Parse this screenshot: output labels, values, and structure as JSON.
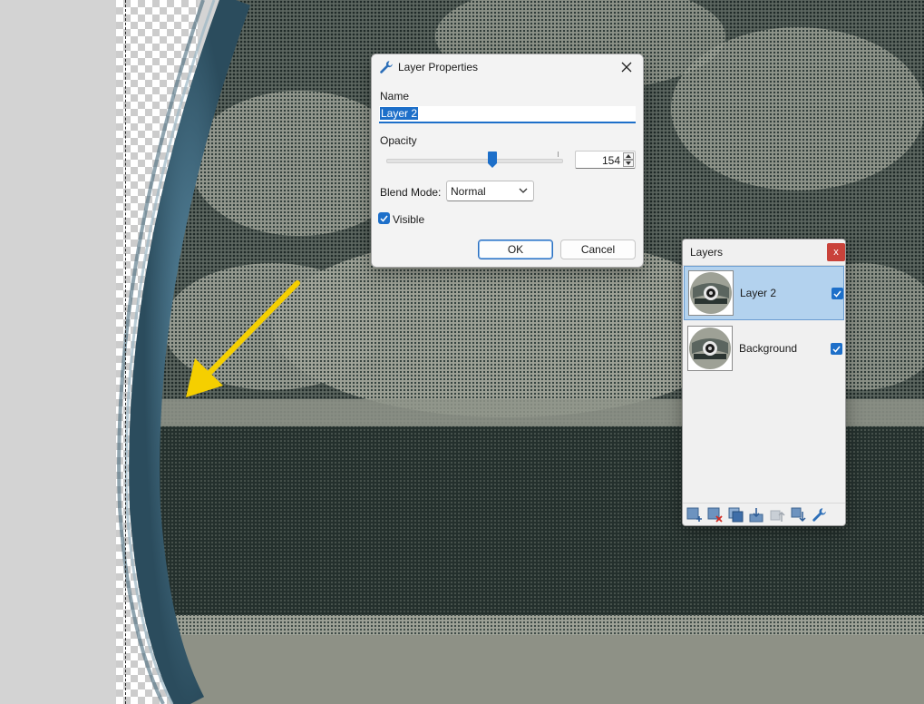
{
  "layer_properties": {
    "title": "Layer Properties",
    "title_icon": "wrench-icon",
    "name_label": "Name",
    "name_value": "Layer 2",
    "opacity_label": "Opacity",
    "opacity_value": "154",
    "opacity_fraction": 0.604,
    "blend_label": "Blend Mode:",
    "blend_value": "Normal",
    "visible_label": "Visible",
    "visible_checked": true,
    "ok_label": "OK",
    "cancel_label": "Cancel"
  },
  "layers_panel": {
    "title": "Layers",
    "close_label": "x",
    "layers": [
      {
        "name": "Layer 2",
        "visible": true,
        "selected": true
      },
      {
        "name": "Background",
        "visible": true,
        "selected": false
      }
    ],
    "toolbar_icons": [
      "add-layer-icon",
      "delete-layer-icon",
      "duplicate-layer-icon",
      "merge-down-icon",
      "move-up-icon",
      "move-down-icon",
      "properties-wrench-icon"
    ]
  },
  "colors": {
    "accent": "#1d6fc9",
    "selected_row": "#b3d2ee",
    "close_red": "#c9423a",
    "arrow_yellow": "#f5cf00"
  }
}
